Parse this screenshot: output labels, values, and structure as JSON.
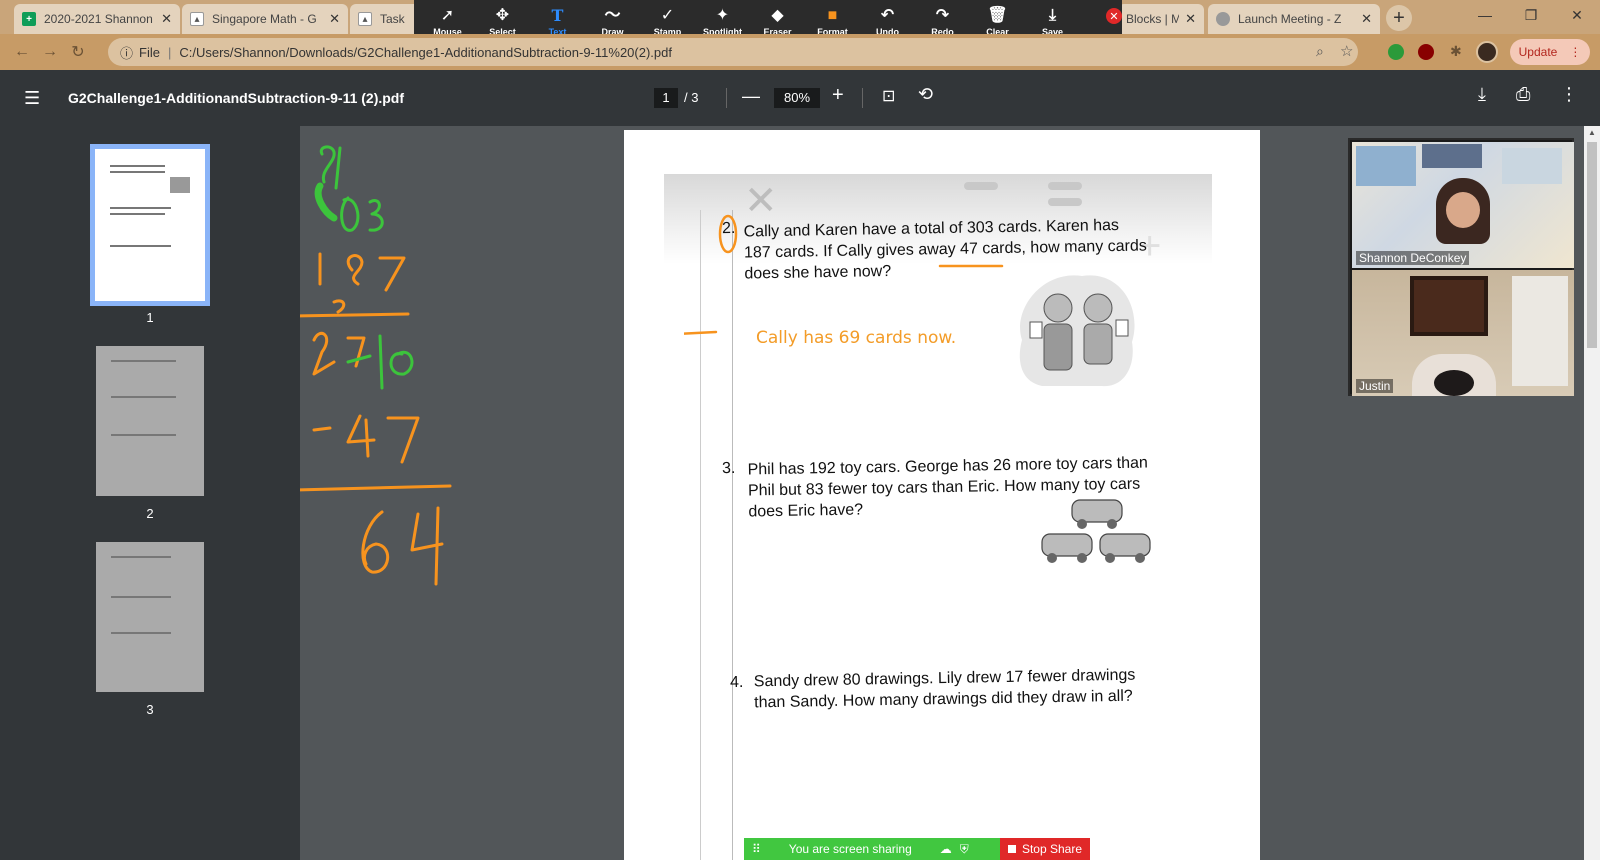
{
  "tabs": [
    {
      "title": "2020-2021 Shannon",
      "favicon": "sheets-icon",
      "color": "#0f9d58"
    },
    {
      "title": "Singapore Math - G",
      "favicon": "person-icon",
      "color": "#777"
    },
    {
      "title": "Task",
      "favicon": "person-icon",
      "color": "#777"
    },
    {
      "title": "Blocks | M",
      "favicon": "",
      "color": ""
    },
    {
      "title": "Launch Meeting - Z",
      "favicon": "globe-icon",
      "color": "#888"
    }
  ],
  "new_tab": "+",
  "window_controls": {
    "minimize": "—",
    "restore": "❐",
    "close": "✕"
  },
  "annotation_tools": [
    {
      "label": "Mouse",
      "icon": "➚"
    },
    {
      "label": "Select",
      "icon": "✥"
    },
    {
      "label": "Text",
      "icon": "T"
    },
    {
      "label": "Draw",
      "icon": "〜"
    },
    {
      "label": "Stamp",
      "icon": "✓"
    },
    {
      "label": "Spotlight",
      "icon": "✦"
    },
    {
      "label": "Eraser",
      "icon": "◆"
    },
    {
      "label": "Format",
      "icon": "■"
    },
    {
      "label": "Undo",
      "icon": "↶"
    },
    {
      "label": "Redo",
      "icon": "↷"
    },
    {
      "label": "Clear",
      "icon": "🗑"
    },
    {
      "label": "Save",
      "icon": "⤓"
    }
  ],
  "annotation_active": "Text",
  "format_color": "#f7931e",
  "address": {
    "scheme_label": "File",
    "url": "C:/Users/Shannon/Downloads/G2Challenge1-AdditionandSubtraction-9-11%20(2).pdf"
  },
  "update_label": "Update",
  "pdf": {
    "title": "G2Challenge1-AdditionandSubtraction-9-11 (2).pdf",
    "current_page": "1",
    "total_pages": "/ 3",
    "zoom": "80%"
  },
  "thumbnails": [
    "1",
    "2",
    "3"
  ],
  "questions": [
    {
      "num": "2.",
      "text_lines": [
        "Cally and Karen have a total of 303 cards. Karen has",
        "187 cards. If Cally gives away 47 cards, how many cards",
        "does she have now?"
      ]
    },
    {
      "num": "3.",
      "text_lines": [
        "Phil has 192 toy cars. George has 26 more toy cars than",
        "Phil but 83 fewer toy cars than Eric. How many toy cars",
        "does Eric have?"
      ]
    },
    {
      "num": "4.",
      "text_lines": [
        "Sandy drew 80 drawings. Lily drew 17 fewer drawings",
        "than Sandy. How many drawings did they draw in all?"
      ]
    }
  ],
  "answer_text": "Cally has 69 cards now.",
  "participants": [
    {
      "name": "Shannon DeConkey"
    },
    {
      "name": "Justin"
    }
  ],
  "share_bar": {
    "status": "You are screen sharing",
    "stop": "Stop Share"
  },
  "colors": {
    "ink_green": "#3cc43c",
    "ink_orange": "#f7931e",
    "pdf_toolbar": "#323639",
    "viewer_bg": "#525659"
  }
}
